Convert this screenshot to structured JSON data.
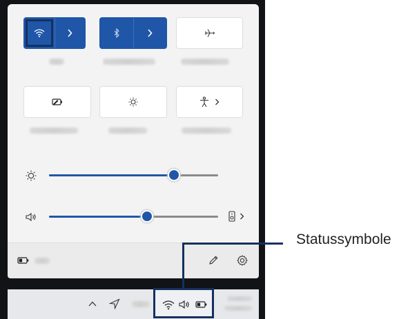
{
  "annotation": {
    "label": "Statussymbole"
  },
  "quick_settings": {
    "tiles": [
      {
        "name": "wifi",
        "icon": "wifi-icon",
        "active": true,
        "has_chevron": true
      },
      {
        "name": "bluetooth",
        "icon": "bluetooth-icon",
        "active": true,
        "has_chevron": true
      },
      {
        "name": "airplane-mode",
        "icon": "airplane-icon",
        "active": false
      },
      {
        "name": "battery-saver",
        "icon": "battery-saver-icon",
        "active": false
      },
      {
        "name": "night-light",
        "icon": "sun-icon",
        "active": false
      },
      {
        "name": "accessibility",
        "icon": "accessibility-icon",
        "active": false,
        "has_chevron": true
      }
    ],
    "brightness": {
      "icon": "sun-icon",
      "level_percent": 74
    },
    "volume": {
      "icon": "speaker-icon",
      "level_percent": 58,
      "output_icon": "audio-output-icon"
    }
  },
  "footer": {
    "battery_icon": "battery-icon",
    "edit_icon": "pencil-icon",
    "settings_icon": "gear-icon"
  },
  "taskbar": {
    "chevron_icon": "chevron-up-icon",
    "pen_icon": "pen-icon",
    "tray_icons": [
      "wifi-icon",
      "speaker-icon",
      "battery-icon"
    ]
  },
  "colors": {
    "accent": "#1f56a8",
    "highlight": "#14305e",
    "panel": "#f3f3f3",
    "frame": "#111317"
  }
}
